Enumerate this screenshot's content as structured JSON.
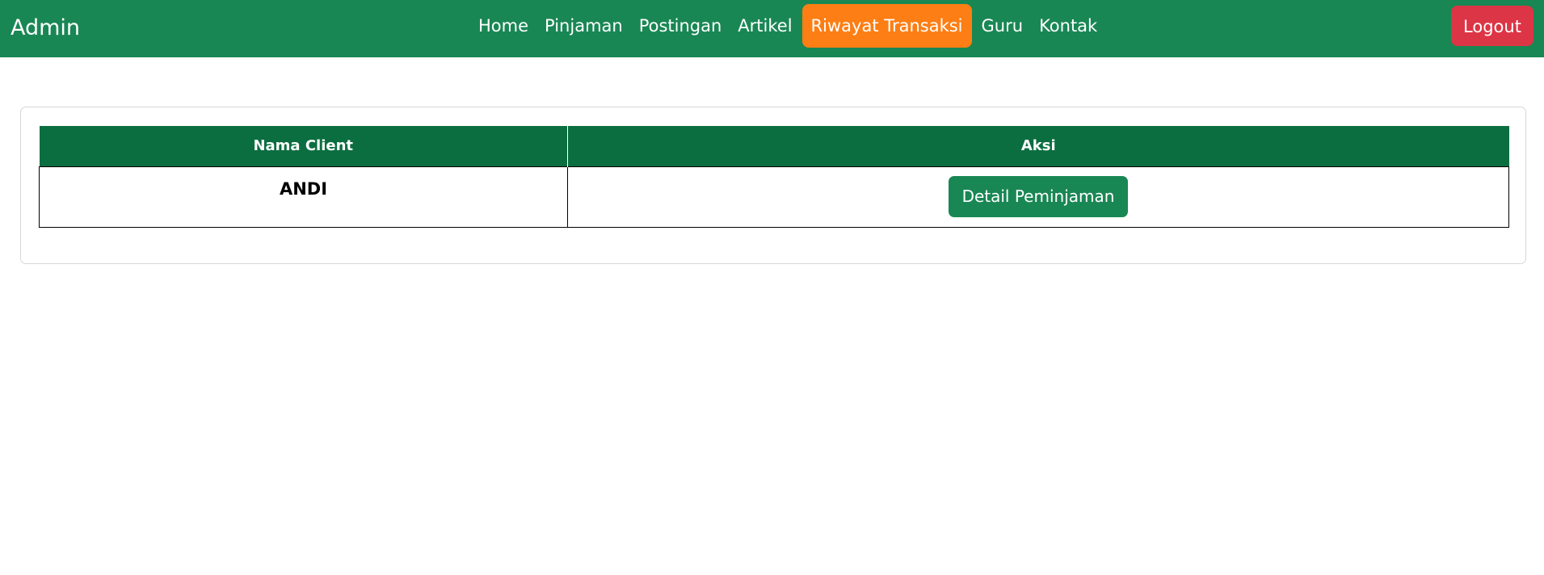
{
  "navbar": {
    "brand": "Admin",
    "links": [
      {
        "label": "Home",
        "active": false
      },
      {
        "label": "Pinjaman",
        "active": false
      },
      {
        "label": "Postingan",
        "active": false
      },
      {
        "label": "Artikel",
        "active": false
      },
      {
        "label": "Riwayat Transaksi",
        "active": true
      },
      {
        "label": "Guru",
        "active": false
      },
      {
        "label": "Kontak",
        "active": false
      }
    ],
    "logout_label": "Logout"
  },
  "table": {
    "headers": [
      "Nama Client",
      "Aksi"
    ],
    "rows": [
      {
        "client_name": "ANDI",
        "action_label": "Detail Peminjaman"
      }
    ]
  },
  "colors": {
    "navbar_bg": "#198754",
    "active_link_bg": "#fd7e14",
    "logout_bg": "#dc3545",
    "table_header_bg": "#0b6e40",
    "detail_button_bg": "#198754"
  }
}
